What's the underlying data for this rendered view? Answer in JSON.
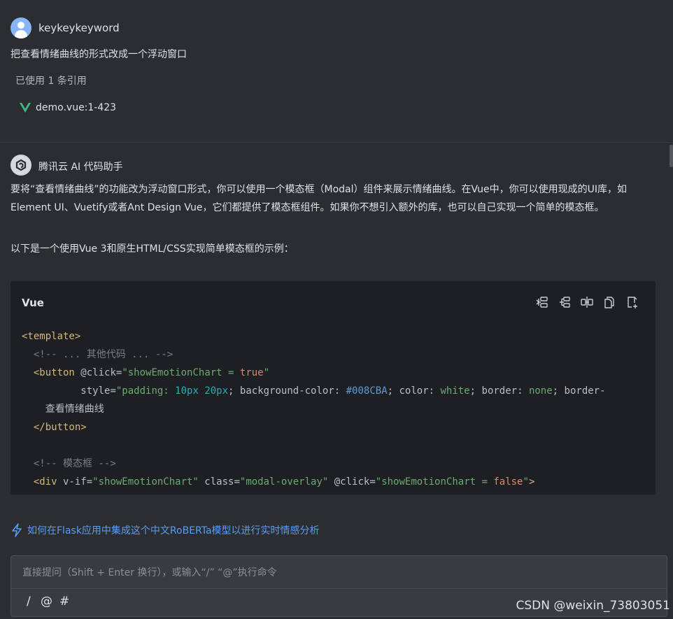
{
  "user": {
    "name": "keykeykeyword",
    "message": "把查看情绪曲线的形式改成一个浮动窗口",
    "references_label": "已使用 1 条引用",
    "reference_file": "demo.vue:1-423"
  },
  "assistant": {
    "name": "腾讯云 AI 代码助手",
    "paragraph1": "要将“查看情绪曲线”的功能改为浮动窗口形式，你可以使用一个模态框（Modal）组件来展示情绪曲线。在Vue中，你可以使用现成的UI库，如Element UI、Vuetify或者Ant Design Vue，它们都提供了模态框组件。如果你不想引入额外的库，也可以自己实现一个简单的模态框。",
    "paragraph2": "以下是一个使用Vue 3和原生HTML/CSS实现简单模态框的示例："
  },
  "code_block": {
    "language": "Vue",
    "tools": [
      "insert-icon",
      "new-file-icon",
      "diff-icon",
      "copy-icon",
      "save-file-icon"
    ],
    "tokens": {
      "template_open": "<template>",
      "comment1": "<!-- ... 其他代码 ... -->",
      "button_open": "<button",
      "click_attr": " @click=",
      "click_val1": "\"showEmotionChart = ",
      "true_kw": "true",
      "quote": "\"",
      "style_attr": "style=",
      "style_p1": "\"padding: ",
      "v10px": "10px",
      "v20px": "20px",
      "style_p2": "; background-color: ",
      "color_val": "#008CBA",
      "style_p3": "; color: ",
      "white_val": "white",
      "style_p4": "; border: ",
      "none_val": "none",
      "style_p5": "; border-",
      "button_text": "查看情绪曲线",
      "button_close": "</button>",
      "comment2": "<!-- 模态框 -->",
      "div_open": "<div",
      "vif_attr": " v-if=",
      "vif_val": "\"showEmotionChart\"",
      "class_attr": " class=",
      "class_val": "\"modal-overlay\"",
      "click_attr2": " @click=",
      "click_val2": "\"showEmotionChart = ",
      "false_kw": "false",
      "gt": ">"
    }
  },
  "suggestion": "如何在Flask应用中集成这个中文RoBERTa模型以进行实时情感分析",
  "input": {
    "placeholder": "直接提问（Shift + Enter 换行），或输入“/” “@”执行命令",
    "value": "",
    "commands": [
      "/",
      "@",
      "#"
    ]
  },
  "watermark": "CSDN @weixin_73803051",
  "colors": {
    "background": "#2b2d30",
    "code_background": "#1e1f22",
    "link": "#589df6",
    "vue_green": "#41b883"
  }
}
